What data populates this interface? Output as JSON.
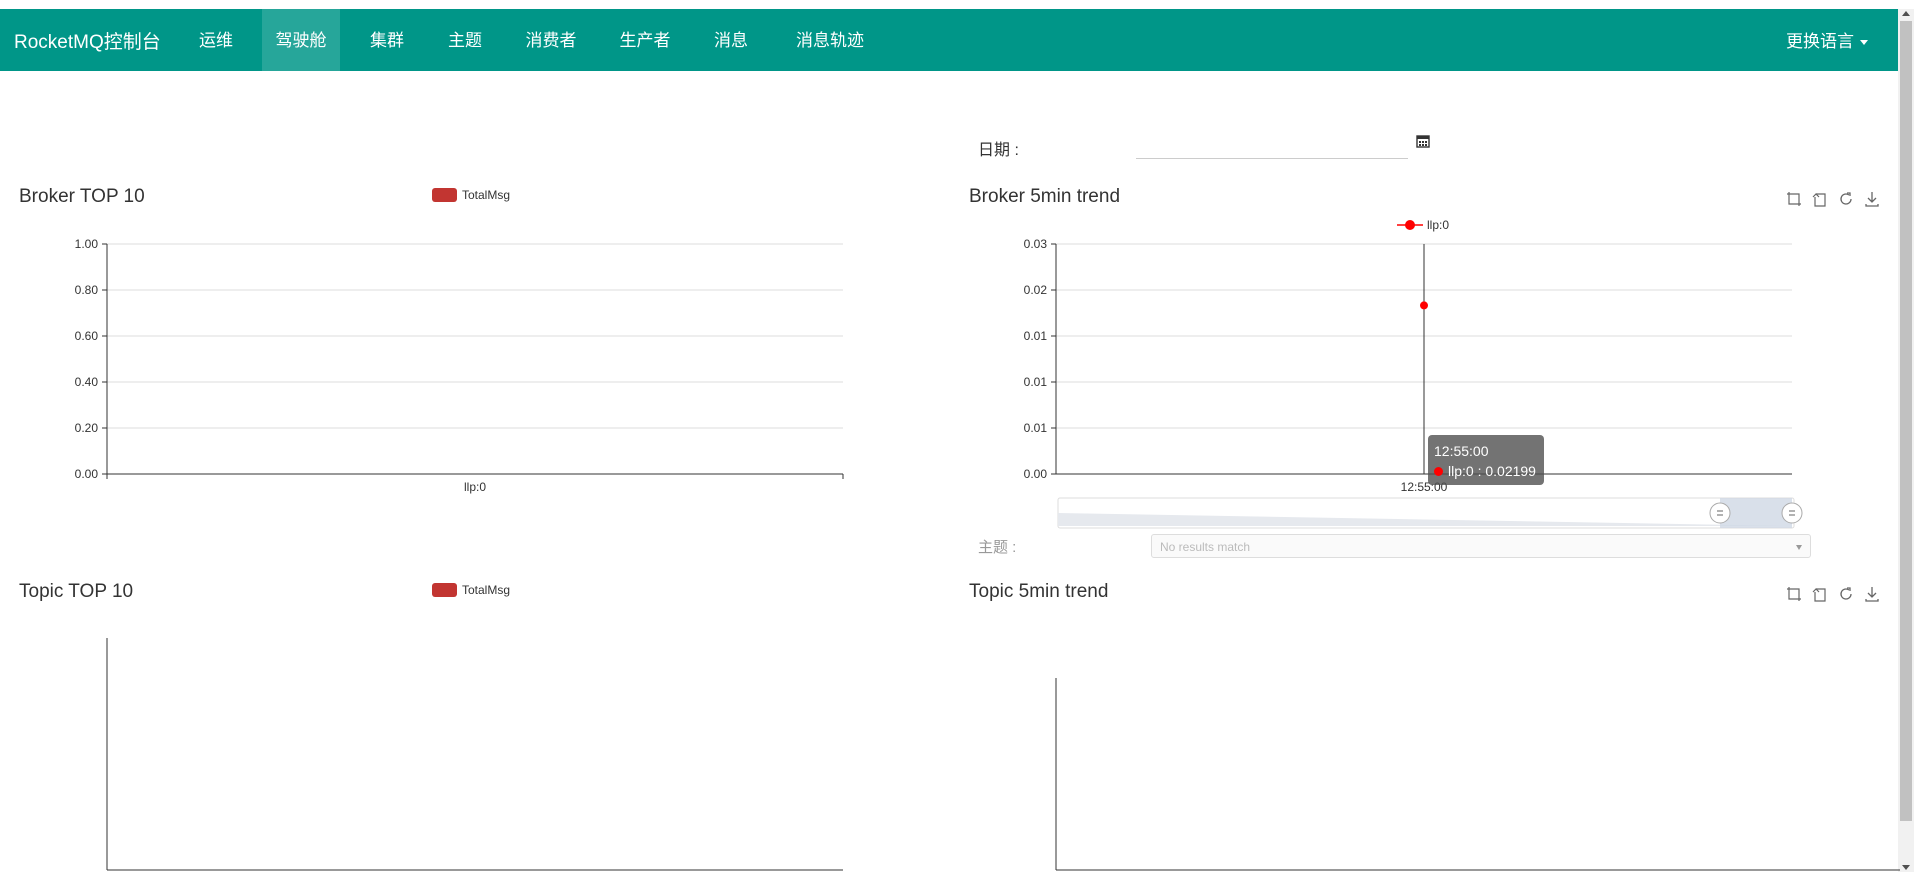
{
  "nav": {
    "brand": "RocketMQ控制台",
    "items": [
      {
        "label": "运维"
      },
      {
        "label": "驾驶舱"
      },
      {
        "label": "集群"
      },
      {
        "label": "主题"
      },
      {
        "label": "消费者"
      },
      {
        "label": "生产者"
      },
      {
        "label": "消息"
      },
      {
        "label": "消息轨迹"
      }
    ],
    "active_item": "驾驶舱",
    "language_label": "更换语言",
    "color": "#009688"
  },
  "date_filter": {
    "label": "日期 :",
    "value": ""
  },
  "topic_filter": {
    "label": "主题 :",
    "placeholder": "No results match"
  },
  "panels": {
    "broker_top10": {
      "title": "Broker TOP 10",
      "legend": "TotalMsg"
    },
    "broker_trend": {
      "title": "Broker 5min trend",
      "legend": "llp:0",
      "tooltip_time": "12:55:00",
      "tooltip_value": "llp:0 : 0.02199",
      "toolbox": [
        "zoom-icon",
        "zoom-reset-icon",
        "restore-icon",
        "download-icon"
      ]
    },
    "topic_top10": {
      "title": "Topic TOP 10",
      "legend": "TotalMsg"
    },
    "topic_trend": {
      "title": "Topic 5min trend",
      "toolbox": [
        "zoom-icon",
        "zoom-reset-icon",
        "restore-icon",
        "download-icon"
      ]
    }
  },
  "chart_data": [
    {
      "type": "bar",
      "title": "Broker TOP 10",
      "categories": [
        "llp:0"
      ],
      "series": [
        {
          "name": "TotalMsg",
          "values": [
            0
          ]
        }
      ],
      "yticks": [
        "0.00",
        "0.20",
        "0.40",
        "0.60",
        "0.80",
        "1.00"
      ],
      "ylim": [
        0,
        1
      ],
      "grid": true,
      "legend": "top",
      "colors": [
        "#c23531"
      ]
    },
    {
      "type": "line",
      "title": "Broker 5min trend",
      "x": [
        "12:55:00"
      ],
      "series": [
        {
          "name": "llp:0",
          "values": [
            0.02199
          ]
        }
      ],
      "yticks": [
        "0.00",
        "0.01",
        "0.01",
        "0.01",
        "0.02",
        "0.03"
      ],
      "ylim": [
        0,
        0.03
      ],
      "grid": true,
      "legend": "top",
      "colors": [
        "#ff0000"
      ]
    },
    {
      "type": "bar",
      "title": "Topic TOP 10",
      "categories": [],
      "series": [
        {
          "name": "TotalMsg",
          "values": []
        }
      ],
      "legend": "top",
      "colors": [
        "#c23531"
      ]
    },
    {
      "type": "line",
      "title": "Topic 5min trend",
      "x": [],
      "series": []
    }
  ]
}
